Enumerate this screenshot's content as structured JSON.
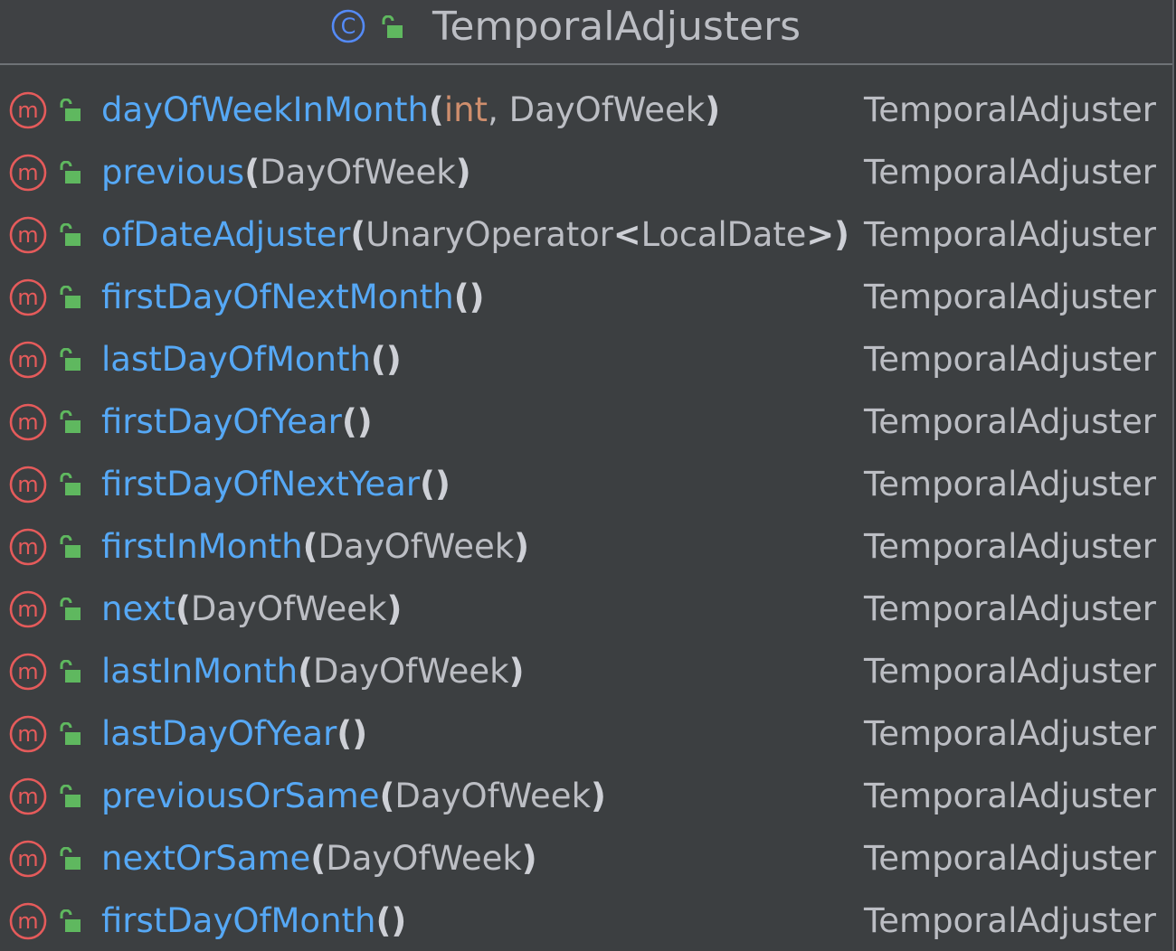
{
  "class": {
    "name": "TemporalAdjusters",
    "kind_icon": "class-c-icon",
    "visibility_icon": "public-lock-icon",
    "colors": {
      "background": "#3c3f41",
      "header_background": "#3f4144",
      "method_name": "#56a8f5",
      "primitive_type": "#cf8e6d",
      "text": "#bcbec4",
      "class_icon": "#548af7",
      "method_icon": "#e55b5b",
      "lock_icon": "#5fb85f"
    }
  },
  "members": [
    {
      "name": "dayOfWeekInMonth",
      "open": "(",
      "params": [
        {
          "text": "int",
          "kind": "primitive"
        },
        {
          "text": ", DayOfWeek",
          "kind": "type"
        }
      ],
      "close": ")",
      "return_type": "TemporalAdjuster"
    },
    {
      "name": "previous",
      "open": "(",
      "params": [
        {
          "text": "DayOfWeek",
          "kind": "type"
        }
      ],
      "close": ")",
      "return_type": "TemporalAdjuster"
    },
    {
      "name": "ofDateAdjuster",
      "open": "(",
      "params": [
        {
          "text": "UnaryOperator",
          "kind": "type"
        },
        {
          "text": "<",
          "kind": "bracket"
        },
        {
          "text": "LocalDate",
          "kind": "type"
        },
        {
          "text": ">",
          "kind": "bracket"
        }
      ],
      "close": ")",
      "return_type": "TemporalAdjuster"
    },
    {
      "name": "firstDayOfNextMonth",
      "open": "(",
      "params": [],
      "close": ")",
      "return_type": "TemporalAdjuster"
    },
    {
      "name": "lastDayOfMonth",
      "open": "(",
      "params": [],
      "close": ")",
      "return_type": "TemporalAdjuster"
    },
    {
      "name": "firstDayOfYear",
      "open": "(",
      "params": [],
      "close": ")",
      "return_type": "TemporalAdjuster"
    },
    {
      "name": "firstDayOfNextYear",
      "open": "(",
      "params": [],
      "close": ")",
      "return_type": "TemporalAdjuster"
    },
    {
      "name": "firstInMonth",
      "open": "(",
      "params": [
        {
          "text": "DayOfWeek",
          "kind": "type"
        }
      ],
      "close": ")",
      "return_type": "TemporalAdjuster"
    },
    {
      "name": "next",
      "open": "(",
      "params": [
        {
          "text": "DayOfWeek",
          "kind": "type"
        }
      ],
      "close": ")",
      "return_type": "TemporalAdjuster"
    },
    {
      "name": "lastInMonth",
      "open": "(",
      "params": [
        {
          "text": "DayOfWeek",
          "kind": "type"
        }
      ],
      "close": ")",
      "return_type": "TemporalAdjuster"
    },
    {
      "name": "lastDayOfYear",
      "open": "(",
      "params": [],
      "close": ")",
      "return_type": "TemporalAdjuster"
    },
    {
      "name": "previousOrSame",
      "open": "(",
      "params": [
        {
          "text": "DayOfWeek",
          "kind": "type"
        }
      ],
      "close": ")",
      "return_type": "TemporalAdjuster"
    },
    {
      "name": "nextOrSame",
      "open": "(",
      "params": [
        {
          "text": "DayOfWeek",
          "kind": "type"
        }
      ],
      "close": ")",
      "return_type": "TemporalAdjuster"
    },
    {
      "name": "firstDayOfMonth",
      "open": "(",
      "params": [],
      "close": ")",
      "return_type": "TemporalAdjuster"
    }
  ],
  "member_icon": "method-m-icon",
  "member_visibility_icon": "public-lock-icon"
}
